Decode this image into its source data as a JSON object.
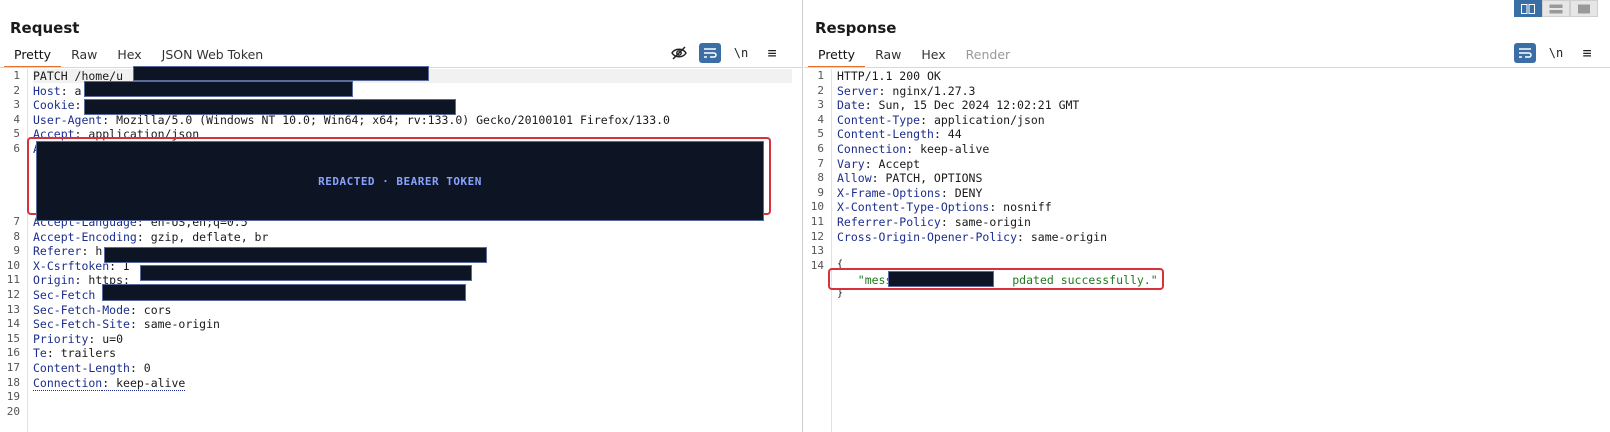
{
  "request": {
    "title": "Request",
    "tabs": [
      "Pretty",
      "Raw",
      "Hex",
      "JSON Web Token"
    ],
    "lines": [
      {
        "k": "",
        "v": "PATCH /home/u"
      },
      {
        "k": "Host",
        "v": ": a"
      },
      {
        "k": "Cookie",
        "v": ":"
      },
      {
        "k": "User-Agent",
        "v": ": Mozilla/5.0 (Windows NT 10.0; Win64; x64; rv:133.0) Gecko/20100101 Firefox/133.0"
      },
      {
        "k": "Accept",
        "v": ": application/json"
      },
      {
        "k": "A",
        "v": ""
      },
      {
        "k": "Accept-Language",
        "v": ": en-US,en;q=0.5"
      },
      {
        "k": "Accept-Encoding",
        "v": ": gzip, deflate, br"
      },
      {
        "k": "Referer",
        "v": ": h"
      },
      {
        "k": "X-Csrftoken",
        "v": ": I"
      },
      {
        "k": "Origin",
        "v": ": https:"
      },
      {
        "k": "Sec-Fetch",
        "v": ""
      },
      {
        "k": "Sec-Fetch-Mode",
        "v": ": cors"
      },
      {
        "k": "Sec-Fetch-Site",
        "v": ": same-origin"
      },
      {
        "k": "Priority",
        "v": ": u=0"
      },
      {
        "k": "Te",
        "v": ": trailers"
      },
      {
        "k": "Content-Length",
        "v": ": 0"
      },
      {
        "k": "Connection",
        "v": ": keep-alive"
      }
    ],
    "line_numbers": [
      "1",
      "2",
      "3",
      "4",
      "5",
      "6",
      "7",
      "8",
      "9",
      "10",
      "11",
      "12",
      "13",
      "14",
      "15",
      "16",
      "17",
      "18",
      "19",
      "20"
    ],
    "redaction_label": "REDACTED · BEARER TOKEN"
  },
  "response": {
    "title": "Response",
    "tabs": [
      "Pretty",
      "Raw",
      "Hex",
      "Render"
    ],
    "lines": [
      {
        "k": "",
        "v": "HTTP/1.1 200 OK"
      },
      {
        "k": "Server",
        "v": ": nginx/1.27.3"
      },
      {
        "k": "Date",
        "v": ": Sun, 15 Dec 2024 12:02:21 GMT"
      },
      {
        "k": "Content-Type",
        "v": ": application/json"
      },
      {
        "k": "Content-Length",
        "v": ": 44"
      },
      {
        "k": "Connection",
        "v": ": keep-alive"
      },
      {
        "k": "Vary",
        "v": ": Accept"
      },
      {
        "k": "Allow",
        "v": ": PATCH, OPTIONS"
      },
      {
        "k": "X-Frame-Options",
        "v": ": DENY"
      },
      {
        "k": "X-Content-Type-Options",
        "v": ": nosniff"
      },
      {
        "k": "Referrer-Policy",
        "v": ": same-origin"
      },
      {
        "k": "Cross-Origin-Opener-Policy",
        "v": ": same-origin"
      },
      {
        "k": "",
        "v": ""
      },
      {
        "k": "",
        "v": "{"
      }
    ],
    "line_numbers": [
      "1",
      "2",
      "3",
      "4",
      "5",
      "6",
      "7",
      "8",
      "9",
      "10",
      "11",
      "12",
      "13",
      "14"
    ],
    "json_message_start": "\"messag",
    "json_message_end": "pdated successfully.\"",
    "json_close": "}"
  },
  "toolbar": {
    "newline_label": "\\n",
    "menu_label": "≡"
  },
  "colors": {
    "accent": "#e8702a",
    "tool_blue": "#3a6ea5",
    "header_key": "#1c2e8f",
    "json_string": "#1f7a1f",
    "highlight_box": "#d9313b",
    "redaction": "#0d1424"
  }
}
